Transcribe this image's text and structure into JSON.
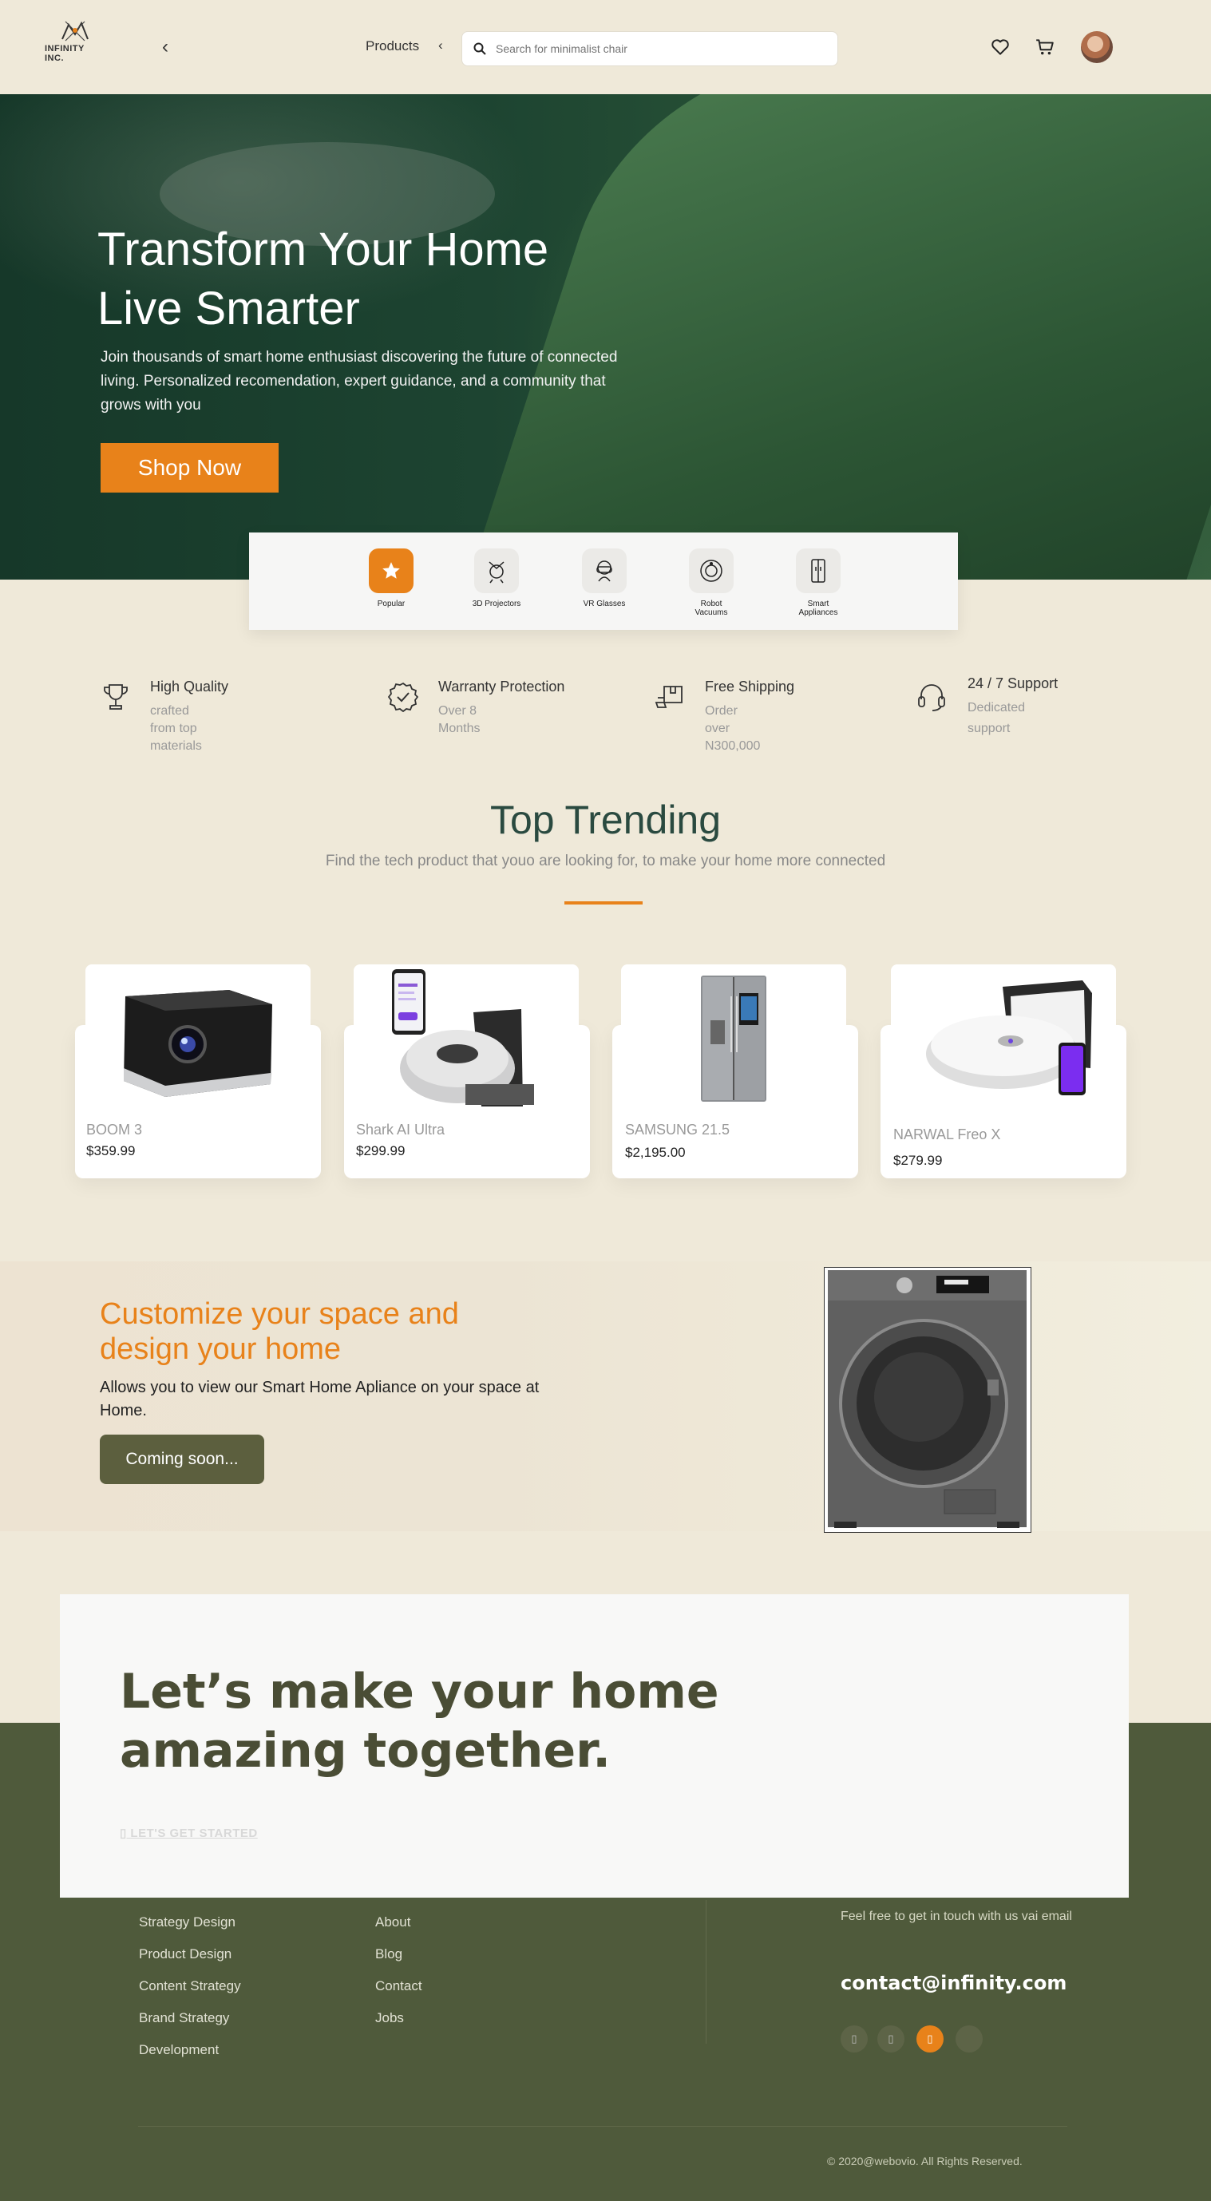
{
  "header": {
    "logo_text": "INFINITY INC.",
    "back_glyph": "‹",
    "nav_label": "Products",
    "nav_glyph": "‹",
    "search_placeholder": "Search for minimalist chair",
    "icons": [
      "heart-icon",
      "cart-icon",
      "avatar"
    ]
  },
  "hero": {
    "title_line1": "Transform Your Home",
    "title_line2": "Live Smarter",
    "subtitle": "Join thousands of smart home enthusiast discovering the future of connected living. Personalized recomendation, expert guidance, and a community that grows with you",
    "cta_label": "Shop Now"
  },
  "categories": [
    {
      "label": "Popular",
      "icon": "star-icon",
      "active": true
    },
    {
      "label": "3D Projectors",
      "icon": "projector-icon",
      "active": false
    },
    {
      "label": "VR Glasses",
      "icon": "vr-glasses-icon",
      "active": false
    },
    {
      "label": "Robot Vacuums",
      "icon": "robot-vacuum-icon",
      "active": false
    },
    {
      "label": "Smart Appliances",
      "icon": "fridge-icon",
      "active": false
    }
  ],
  "features": [
    {
      "title": "High Quality",
      "subtitle": "crafted from top materials",
      "icon": "trophy-icon"
    },
    {
      "title": "Warranty Protection",
      "subtitle": "Over 8 Months",
      "icon": "check-badge-icon"
    },
    {
      "title": "Free Shipping",
      "subtitle": "Order over N300,000",
      "icon": "shipping-box-icon"
    },
    {
      "title": "24 / 7 Support",
      "subtitle": "Dedicated support",
      "icon": "headset-icon"
    }
  ],
  "trending": {
    "title": "Top Trending",
    "subtitle": "Find the tech product that youo are looking for, to make your home more connected",
    "products": [
      {
        "name": "BOOM 3",
        "price": "$359.99",
        "image": "projector"
      },
      {
        "name": "Shark AI Ultra",
        "price": "$299.99",
        "image": "robot-vacuum-phone"
      },
      {
        "name": "SAMSUNG 21.5",
        "price": "$2,195.00",
        "image": "refrigerator"
      },
      {
        "name": "NARWAL Freo X",
        "price": "$279.99",
        "image": "robot-mop"
      }
    ]
  },
  "customize": {
    "title": "Customize your space and design your home",
    "subtitle": "Allows you to view our Smart Home Apliance on your space at Home.",
    "button_label": "Coming soon...",
    "image": "washing-machine"
  },
  "cta": {
    "title_line1": "Let’s make your home",
    "title_line2": "amazing together.",
    "link_label": "LET'S GET STARTED"
  },
  "footer": {
    "col1": [
      "Strategy Design",
      "Product Design",
      "Content Strategy",
      "Brand Strategy",
      "Development"
    ],
    "col2": [
      "About",
      "Blog",
      "Contact",
      "Jobs"
    ],
    "contact_sub": "Feel free to get in touch with us vai email",
    "email": "contact@infinity.com",
    "copyright": "© 2020@webovio. All Rights Reserved."
  },
  "colors": {
    "accent": "#e8821a",
    "background": "#efe9d9",
    "dark_green": "#2a4a40",
    "olive": "#4f5a3b",
    "button_olive": "#5c5f3e"
  }
}
